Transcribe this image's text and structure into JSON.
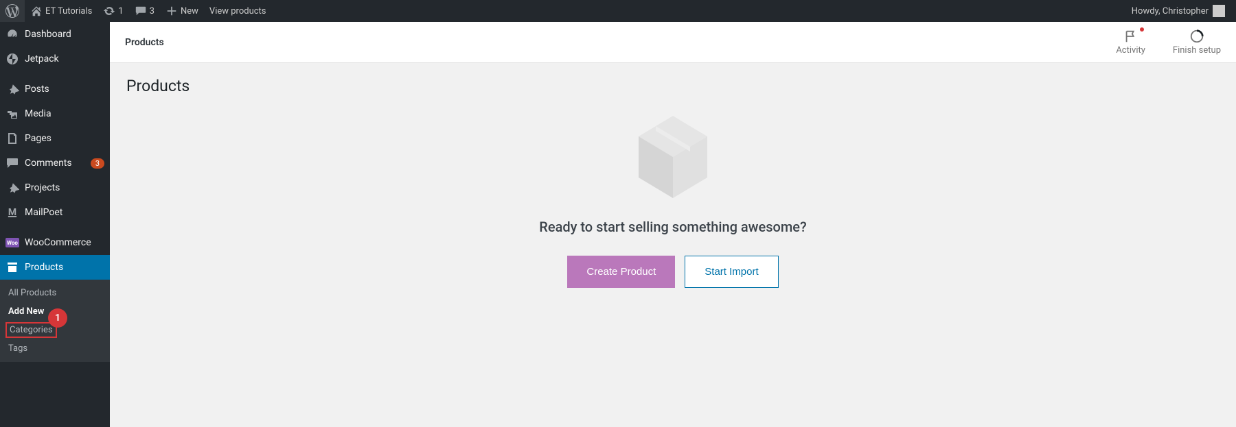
{
  "adminBar": {
    "siteName": "ET Tutorials",
    "updatesCount": "1",
    "commentsCount": "3",
    "newLabel": "New",
    "viewProductsLabel": "View products",
    "greeting": "Howdy, Christopher"
  },
  "sidebar": {
    "items": [
      {
        "label": "Dashboard",
        "icon": "dashboard"
      },
      {
        "label": "Jetpack",
        "icon": "jetpack"
      },
      {
        "label": "Posts",
        "icon": "pin"
      },
      {
        "label": "Media",
        "icon": "media"
      },
      {
        "label": "Pages",
        "icon": "page"
      },
      {
        "label": "Comments",
        "icon": "comment",
        "badge": "3"
      },
      {
        "label": "Projects",
        "icon": "pin"
      },
      {
        "label": "MailPoet",
        "icon": "mailpoet"
      },
      {
        "label": "WooCommerce",
        "icon": "woo"
      },
      {
        "label": "Products",
        "icon": "archive",
        "current": true
      }
    ],
    "submenu": [
      {
        "label": "All Products"
      },
      {
        "label": "Add New",
        "current": true
      },
      {
        "label": "Categories",
        "highlighted": true
      },
      {
        "label": "Tags"
      }
    ]
  },
  "annotation": {
    "number": "1"
  },
  "header": {
    "title": "Products",
    "activityLabel": "Activity",
    "finishSetupLabel": "Finish setup"
  },
  "content": {
    "pageTitle": "Products",
    "emptyHeading": "Ready to start selling something awesome?",
    "createProductLabel": "Create Product",
    "startImportLabel": "Start Import"
  }
}
